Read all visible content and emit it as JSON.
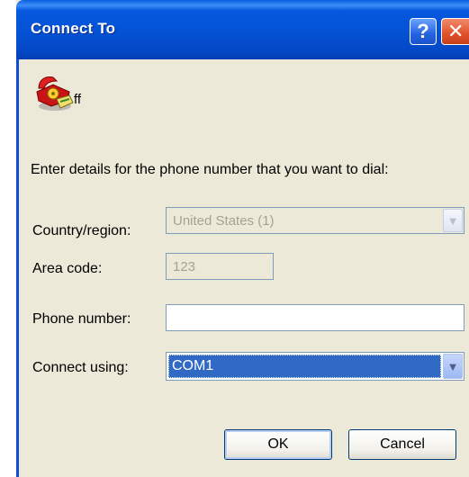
{
  "window": {
    "title": "Connect To",
    "help_glyph": "?",
    "close_glyph": "✕"
  },
  "connection": {
    "icon": "phone-icon",
    "name": "ff"
  },
  "form": {
    "instructions": "Enter details for the phone number that you want to dial:",
    "country_label": "Country/region:",
    "country_value": "United States (1)",
    "area_code_label": "Area code:",
    "area_code_value": "123",
    "phone_label": "Phone number:",
    "phone_value": "",
    "connect_using_label": "Connect using:",
    "connect_using_value": "COM1"
  },
  "buttons": {
    "ok": "OK",
    "cancel": "Cancel"
  },
  "colors": {
    "title_bar": "#0453d7",
    "selection": "#316ac5",
    "dialog_bg": "#ece9d8"
  }
}
